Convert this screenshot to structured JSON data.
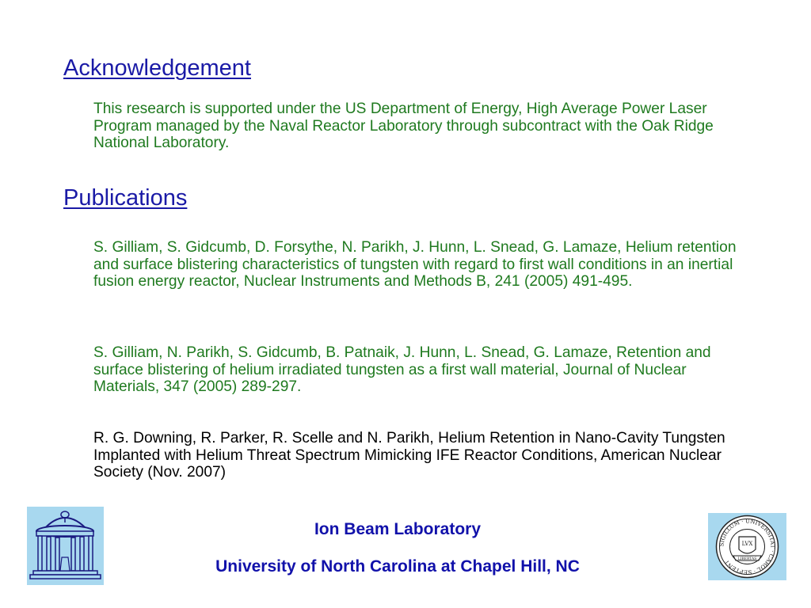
{
  "acknowledgement": {
    "heading": "Acknowledgement",
    "text": "This research is supported under the US Department of Energy, High Average Power Laser Program managed by the Naval Reactor Laboratory through subcontract with the Oak Ridge National Laboratory."
  },
  "publications": {
    "heading": "Publications",
    "items": [
      "S. Gilliam, S. Gidcumb, D. Forsythe, N. Parikh, J. Hunn, L. Snead, G. Lamaze, Helium retention and surface blistering characteristics of tungsten with regard to first wall conditions in an inertial fusion energy reactor, Nuclear Instruments and Methods B, 241 (2005) 491-495.",
      "S. Gilliam, N. Parikh, S. Gidcumb, B. Patnaik, J. Hunn, L. Snead, G. Lamaze, Retention and surface blistering of helium irradiated tungsten as a first wall material, Journal of Nuclear Materials, 347 (2005) 289-297.",
      "R. G. Downing, R. Parker, R. Scelle and N. Parikh, Helium Retention in Nano-Cavity Tungsten Implanted with Helium Threat Spectrum Mimicking IFE Reactor Conditions, American Nuclear Society (Nov. 2007)"
    ]
  },
  "footer": {
    "lab": "Ion Beam Laboratory",
    "university": "University of North Carolina at Chapel Hill, NC"
  },
  "logos": {
    "left": "old-well-logo-icon",
    "right": "university-seal-icon",
    "seal_text": "SIGILLUM · UNIVERSITAT · CAROL · SEPTENT",
    "seal_center": "LVX",
    "seal_banner": "LIBERTAS"
  },
  "colors": {
    "heading": "#1a1aa6",
    "green_text": "#1f7a1f",
    "footer_text": "#1111aa",
    "logo_bg": "#a8d8ef"
  }
}
